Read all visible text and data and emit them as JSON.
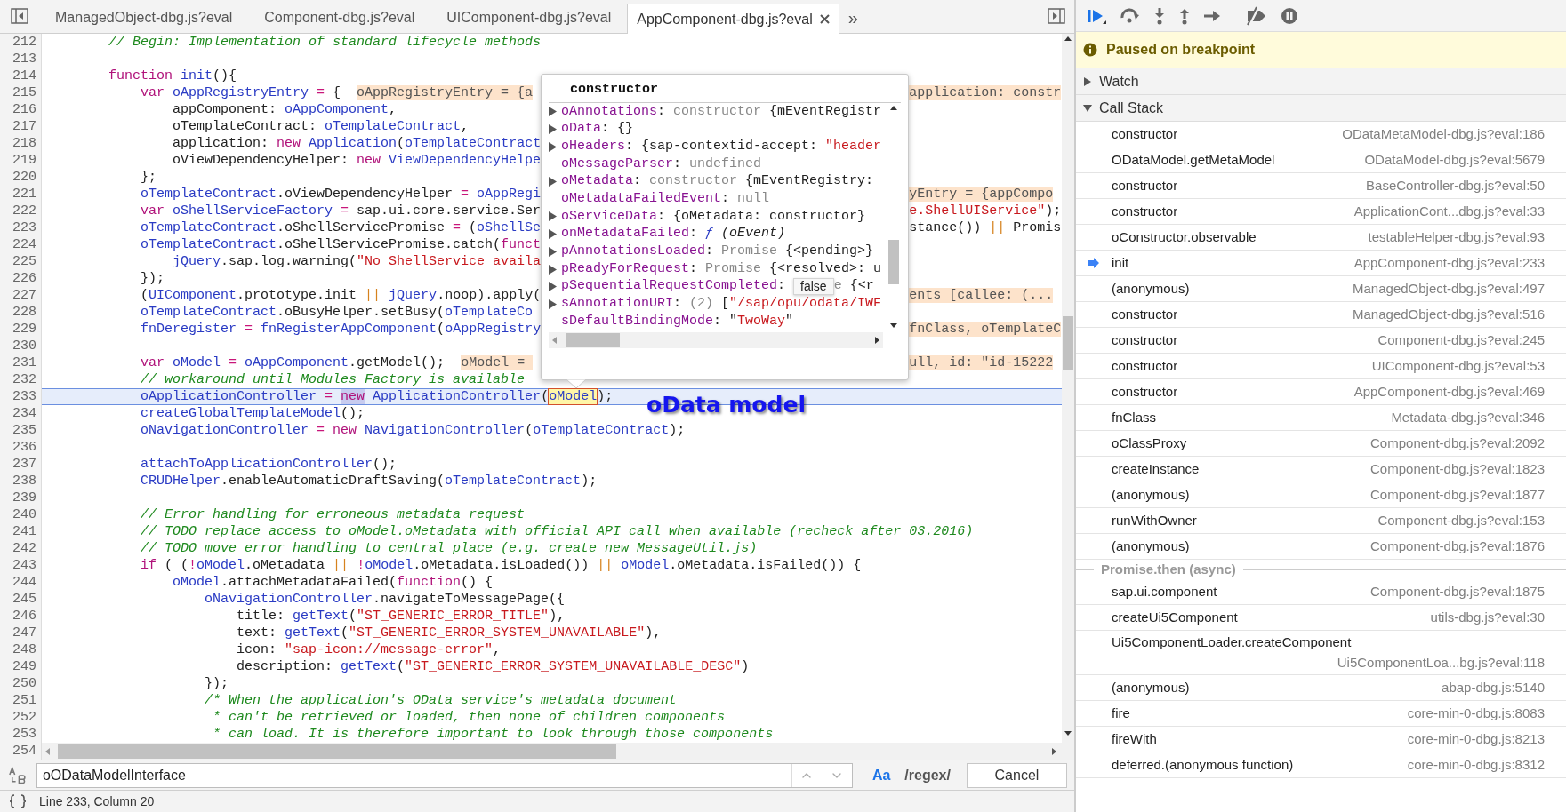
{
  "tabs": [
    {
      "label": "ManagedObject-dbg.js?eval",
      "selected": false,
      "closable": false
    },
    {
      "label": "Component-dbg.js?eval",
      "selected": false,
      "closable": false
    },
    {
      "label": "UIComponent-dbg.js?eval",
      "selected": false,
      "closable": false
    },
    {
      "label": "AppComponent-dbg.js?eval",
      "selected": true,
      "closable": true
    }
  ],
  "more_tabs": "»",
  "code_lines": [
    {
      "n": "212",
      "current": false,
      "tokens": [
        {
          "kind": "cm",
          "text": "        // Begin: Implementation of standard lifecycle methods"
        }
      ]
    },
    {
      "n": "213",
      "current": false
    },
    {
      "n": "214",
      "current": false,
      "tokens": [
        {
          "kind": "kw",
          "text": "        function "
        },
        {
          "kind": "id",
          "text": "init"
        },
        {
          "kind": "pl",
          "text": "(){"
        }
      ]
    },
    {
      "n": "215",
      "current": false,
      "tokens": [
        {
          "kind": "kw",
          "text": "            var "
        },
        {
          "kind": "id",
          "text": "oAppRegistryEntry"
        },
        {
          "kind": "op",
          "text": " = "
        },
        {
          "kind": "pl",
          "text": "{  "
        },
        {
          "kind": "hint",
          "text": "oAppRegistryEntry = {a"
        }
      ],
      "right": [
        {
          "kind": "hint",
          "text": "application: constr"
        }
      ]
    },
    {
      "n": "216",
      "current": false,
      "tokens": [
        {
          "kind": "pl",
          "text": "                appComponent: "
        },
        {
          "kind": "id",
          "text": "oAppComponent"
        },
        {
          "kind": "pl",
          "text": ","
        }
      ]
    },
    {
      "n": "217",
      "current": false,
      "tokens": [
        {
          "kind": "pl",
          "text": "                oTemplateContract: "
        },
        {
          "kind": "id",
          "text": "oTemplateContract"
        },
        {
          "kind": "pl",
          "text": ","
        }
      ]
    },
    {
      "n": "218",
      "current": false,
      "tokens": [
        {
          "kind": "pl",
          "text": "                application: "
        },
        {
          "kind": "kw",
          "text": "new "
        },
        {
          "kind": "id",
          "text": "Application"
        },
        {
          "kind": "pl",
          "text": "("
        },
        {
          "kind": "id",
          "text": "oTemplateContract"
        }
      ]
    },
    {
      "n": "219",
      "current": false,
      "tokens": [
        {
          "kind": "pl",
          "text": "                oViewDependencyHelper: "
        },
        {
          "kind": "kw",
          "text": "new "
        },
        {
          "kind": "id",
          "text": "ViewDependencyHelpe"
        }
      ]
    },
    {
      "n": "220",
      "current": false,
      "tokens": [
        {
          "kind": "pl",
          "text": "            };"
        }
      ]
    },
    {
      "n": "221",
      "current": false,
      "tokens": [
        {
          "kind": "id",
          "text": "            oTemplateContract"
        },
        {
          "kind": "pl",
          "text": ".oViewDependencyHelper"
        },
        {
          "kind": "op",
          "text": " = "
        },
        {
          "kind": "id",
          "text": "oAppRegi"
        }
      ],
      "right": [
        {
          "kind": "hint",
          "text": "yEntry = {appCompo"
        }
      ]
    },
    {
      "n": "222",
      "current": false,
      "tokens": [
        {
          "kind": "kw",
          "text": "            var "
        },
        {
          "kind": "id",
          "text": "oShellServiceFactory"
        },
        {
          "kind": "op",
          "text": " = "
        },
        {
          "kind": "pl",
          "text": "sap.ui.core.service.Ser"
        }
      ],
      "right": [
        {
          "kind": "st",
          "text": "e.ShellUIService\""
        },
        {
          "kind": "pl",
          "text": ");"
        }
      ]
    },
    {
      "n": "223",
      "current": false,
      "tokens": [
        {
          "kind": "id",
          "text": "            oTemplateContract"
        },
        {
          "kind": "pl",
          "text": ".oShellServicePromise"
        },
        {
          "kind": "op",
          "text": " = "
        },
        {
          "kind": "pl",
          "text": "("
        },
        {
          "kind": "id",
          "text": "oShellSe"
        }
      ],
      "right": [
        {
          "kind": "pl",
          "text": "stance()) "
        },
        {
          "kind": "or",
          "text": "||"
        },
        {
          "kind": "pl",
          "text": " Promis"
        }
      ]
    },
    {
      "n": "224",
      "current": false,
      "tokens": [
        {
          "kind": "id",
          "text": "            oTemplateContract"
        },
        {
          "kind": "pl",
          "text": ".oShellServicePromise.catch("
        },
        {
          "kind": "kw",
          "text": "funct"
        }
      ]
    },
    {
      "n": "225",
      "current": false,
      "tokens": [
        {
          "kind": "id",
          "text": "                jQuery"
        },
        {
          "kind": "pl",
          "text": ".sap.log.warning("
        },
        {
          "kind": "st",
          "text": "\"No ShellService availa"
        }
      ]
    },
    {
      "n": "226",
      "current": false,
      "tokens": [
        {
          "kind": "pl",
          "text": "            });"
        }
      ]
    },
    {
      "n": "227",
      "current": false,
      "tokens": [
        {
          "kind": "pl",
          "text": "            ("
        },
        {
          "kind": "id",
          "text": "UIComponent"
        },
        {
          "kind": "pl",
          "text": ".prototype.init "
        },
        {
          "kind": "or",
          "text": "||"
        },
        {
          "kind": "id",
          "text": " jQuery"
        },
        {
          "kind": "pl",
          "text": ".noop).apply("
        }
      ],
      "right": [
        {
          "kind": "hint",
          "text": "ents [callee: (..."
        }
      ]
    },
    {
      "n": "228",
      "current": false,
      "tokens": [
        {
          "kind": "id",
          "text": "            oTemplateContract"
        },
        {
          "kind": "pl",
          "text": ".oBusyHelper.setBusy("
        },
        {
          "kind": "id",
          "text": "oTemplateCo"
        }
      ]
    },
    {
      "n": "229",
      "current": false,
      "tokens": [
        {
          "kind": "id",
          "text": "            fnDeregister"
        },
        {
          "kind": "op",
          "text": " = "
        },
        {
          "kind": "id",
          "text": "fnRegisterAppComponent"
        },
        {
          "kind": "pl",
          "text": "("
        },
        {
          "kind": "id",
          "text": "oAppRegistry"
        }
      ],
      "right": [
        {
          "kind": "hint",
          "text": "fnClass, oTemplateC"
        }
      ]
    },
    {
      "n": "230",
      "current": false
    },
    {
      "n": "231",
      "current": false,
      "tokens": [
        {
          "kind": "kw",
          "text": "            var "
        },
        {
          "kind": "id",
          "text": "oModel"
        },
        {
          "kind": "op",
          "text": " = "
        },
        {
          "kind": "id",
          "text": "oAppComponent"
        },
        {
          "kind": "pl",
          "text": ".getModel();  "
        },
        {
          "kind": "hint",
          "text": "oModel = "
        }
      ],
      "right": [
        {
          "kind": "hint",
          "text": "ull, id: \"id-15222"
        }
      ]
    },
    {
      "n": "232",
      "current": false,
      "tokens": [
        {
          "kind": "cm",
          "text": "            // workaround until Modules Factory is available"
        }
      ]
    },
    {
      "n": "233",
      "current": true,
      "tokens": [
        {
          "kind": "id",
          "text": "            oApplicationController"
        },
        {
          "kind": "op",
          "text": " = "
        },
        {
          "kind": "sel",
          "text": "new"
        },
        {
          "kind": "id",
          "text": " ApplicationController"
        },
        {
          "kind": "pl",
          "text": "("
        },
        {
          "kind": "box",
          "text": "oModel"
        },
        {
          "kind": "pl",
          "text": ");"
        }
      ]
    },
    {
      "n": "234",
      "current": false,
      "tokens": [
        {
          "kind": "id",
          "text": "            createGlobalTemplateModel"
        },
        {
          "kind": "pl",
          "text": "();"
        }
      ]
    },
    {
      "n": "235",
      "current": false,
      "tokens": [
        {
          "kind": "id",
          "text": "            oNavigationController"
        },
        {
          "kind": "op",
          "text": " = "
        },
        {
          "kind": "kw",
          "text": "new "
        },
        {
          "kind": "id",
          "text": "NavigationController"
        },
        {
          "kind": "pl",
          "text": "("
        },
        {
          "kind": "id",
          "text": "oTemplateContract"
        },
        {
          "kind": "pl",
          "text": ");"
        }
      ]
    },
    {
      "n": "236",
      "current": false
    },
    {
      "n": "237",
      "current": false,
      "tokens": [
        {
          "kind": "id",
          "text": "            attachToApplicationController"
        },
        {
          "kind": "pl",
          "text": "();"
        }
      ]
    },
    {
      "n": "238",
      "current": false,
      "tokens": [
        {
          "kind": "id",
          "text": "            CRUDHelper"
        },
        {
          "kind": "pl",
          "text": ".enableAutomaticDraftSaving("
        },
        {
          "kind": "id",
          "text": "oTemplateContract"
        },
        {
          "kind": "pl",
          "text": ");"
        }
      ]
    },
    {
      "n": "239",
      "current": false
    },
    {
      "n": "240",
      "current": false,
      "tokens": [
        {
          "kind": "cm",
          "text": "            // Error handling for erroneous metadata request"
        }
      ]
    },
    {
      "n": "241",
      "current": false,
      "tokens": [
        {
          "kind": "cm",
          "text": "            // TODO replace access to oModel.oMetadata with official API call when available (recheck after 03.2016)"
        }
      ]
    },
    {
      "n": "242",
      "current": false,
      "tokens": [
        {
          "kind": "cm",
          "text": "            // TODO move error handling to central place (e.g. create new MessageUtil.js)"
        }
      ]
    },
    {
      "n": "243",
      "current": false,
      "tokens": [
        {
          "kind": "kw",
          "text": "            if"
        },
        {
          "kind": "pl",
          "text": " ( ("
        },
        {
          "kind": "op",
          "text": "!"
        },
        {
          "kind": "id",
          "text": "oModel"
        },
        {
          "kind": "pl",
          "text": ".oMetadata "
        },
        {
          "kind": "or",
          "text": "||"
        },
        {
          "kind": "op",
          "text": " !"
        },
        {
          "kind": "id",
          "text": "oModel"
        },
        {
          "kind": "pl",
          "text": ".oMetadata.isLoaded()) "
        },
        {
          "kind": "or",
          "text": "||"
        },
        {
          "kind": "id",
          "text": " oModel"
        },
        {
          "kind": "pl",
          "text": ".oMetadata.isFailed()) {"
        }
      ]
    },
    {
      "n": "244",
      "current": false,
      "tokens": [
        {
          "kind": "id",
          "text": "                oModel"
        },
        {
          "kind": "pl",
          "text": ".attachMetadataFailed("
        },
        {
          "kind": "kw",
          "text": "function"
        },
        {
          "kind": "pl",
          "text": "() {"
        }
      ]
    },
    {
      "n": "245",
      "current": false,
      "tokens": [
        {
          "kind": "id",
          "text": "                    oNavigationController"
        },
        {
          "kind": "pl",
          "text": ".navigateToMessagePage({"
        }
      ]
    },
    {
      "n": "246",
      "current": false,
      "tokens": [
        {
          "kind": "pl",
          "text": "                        title: "
        },
        {
          "kind": "id",
          "text": "getText"
        },
        {
          "kind": "pl",
          "text": "("
        },
        {
          "kind": "st",
          "text": "\"ST_GENERIC_ERROR_TITLE\""
        },
        {
          "kind": "pl",
          "text": "),"
        }
      ]
    },
    {
      "n": "247",
      "current": false,
      "tokens": [
        {
          "kind": "pl",
          "text": "                        text: "
        },
        {
          "kind": "id",
          "text": "getText"
        },
        {
          "kind": "pl",
          "text": "("
        },
        {
          "kind": "st",
          "text": "\"ST_GENERIC_ERROR_SYSTEM_UNAVAILABLE\""
        },
        {
          "kind": "pl",
          "text": "),"
        }
      ]
    },
    {
      "n": "248",
      "current": false,
      "tokens": [
        {
          "kind": "pl",
          "text": "                        icon: "
        },
        {
          "kind": "st",
          "text": "\"sap-icon://message-error\""
        },
        {
          "kind": "pl",
          "text": ","
        }
      ]
    },
    {
      "n": "249",
      "current": false,
      "tokens": [
        {
          "kind": "pl",
          "text": "                        description: "
        },
        {
          "kind": "id",
          "text": "getText"
        },
        {
          "kind": "pl",
          "text": "("
        },
        {
          "kind": "st",
          "text": "\"ST_GENERIC_ERROR_SYSTEM_UNAVAILABLE_DESC\""
        },
        {
          "kind": "pl",
          "text": ")"
        }
      ]
    },
    {
      "n": "250",
      "current": false,
      "tokens": [
        {
          "kind": "pl",
          "text": "                    });"
        }
      ]
    },
    {
      "n": "251",
      "current": false,
      "tokens": [
        {
          "kind": "cm",
          "text": "                    /* When the application's OData service's metadata document"
        }
      ]
    },
    {
      "n": "252",
      "current": false,
      "tokens": [
        {
          "kind": "cm",
          "text": "                     * can't be retrieved or loaded, then none of children components"
        }
      ]
    },
    {
      "n": "253",
      "current": false,
      "tokens": [
        {
          "kind": "cm",
          "text": "                     * can load. It is therefore important to look through those components"
        }
      ]
    },
    {
      "n": "254",
      "current": false
    }
  ],
  "popover": {
    "title": "constructor",
    "properties": [
      {
        "kind": "object",
        "name": "oAnnotations",
        "value": [
          {
            "kind": "pl",
            "text": ": "
          },
          {
            "kind": "gy",
            "text": "constructor"
          },
          {
            "kind": "pl",
            "text": " {mEventRegistr"
          }
        ]
      },
      {
        "kind": "object",
        "name": "oData",
        "value": [
          {
            "kind": "pl",
            "text": ": {}"
          }
        ]
      },
      {
        "kind": "object",
        "name": "oHeaders",
        "value": [
          {
            "kind": "pl",
            "text": ": {sap-contextid-accept: "
          },
          {
            "kind": "st",
            "text": "\"header"
          }
        ]
      },
      {
        "kind": "value",
        "name": "oMessageParser",
        "value": [
          {
            "kind": "pl",
            "text": ": "
          },
          {
            "kind": "gy",
            "text": "undefined"
          }
        ]
      },
      {
        "kind": "object",
        "name": "oMetadata",
        "value": [
          {
            "kind": "pl",
            "text": ": "
          },
          {
            "kind": "gy",
            "text": "constructor"
          },
          {
            "kind": "pl",
            "text": " {mEventRegistry:"
          }
        ]
      },
      {
        "kind": "value",
        "name": "oMetadataFailedEvent",
        "value": [
          {
            "kind": "pl",
            "text": ": "
          },
          {
            "kind": "gy",
            "text": "null"
          }
        ]
      },
      {
        "kind": "object",
        "name": "oServiceData",
        "value": [
          {
            "kind": "pl",
            "text": ": {oMetadata: constructor}"
          }
        ]
      },
      {
        "kind": "object",
        "name": "onMetadataFailed",
        "value": [
          {
            "kind": "pl",
            "text": ": "
          },
          {
            "kind": "fn",
            "text": "ƒ"
          },
          {
            "kind": "it",
            "text": " (oEvent)"
          }
        ]
      },
      {
        "kind": "object",
        "name": "pAnnotationsLoaded",
        "value": [
          {
            "kind": "pl",
            "text": ": "
          },
          {
            "kind": "gy",
            "text": "Promise"
          },
          {
            "kind": "pl",
            "text": " {<pending>}"
          }
        ]
      },
      {
        "kind": "object",
        "name": "pReadyForRequest",
        "value": [
          {
            "kind": "pl",
            "text": ": "
          },
          {
            "kind": "gy",
            "text": "Promise"
          },
          {
            "kind": "pl",
            "text": " {<resolved>: u"
          }
        ]
      },
      {
        "kind": "object",
        "name": "pSequentialRequestCompleted",
        "tooltip": "false",
        "value": [
          {
            "kind": "pl",
            "text": ":"
          },
          {
            "kind": "gy",
            "text": "e"
          },
          {
            "kind": "pl",
            "text": " {<r"
          }
        ]
      },
      {
        "kind": "object",
        "name": "sAnnotationURI",
        "value": [
          {
            "kind": "pl",
            "text": ": "
          },
          {
            "kind": "gy",
            "text": "(2)"
          },
          {
            "kind": "pl",
            "text": " ["
          },
          {
            "kind": "st",
            "text": "\"/sap/opu/odata/IWF"
          }
        ]
      },
      {
        "kind": "value",
        "name": "sDefaultBindingMode",
        "value": [
          {
            "kind": "pl",
            "text": ": \""
          },
          {
            "kind": "st",
            "text": "TwoWay"
          },
          {
            "kind": "pl",
            "text": "\""
          }
        ]
      }
    ]
  },
  "annotation": "oData model",
  "search": {
    "value": "oODataModelInterface",
    "case_button": "Aa",
    "regex_button": "/regex/",
    "cancel": "Cancel"
  },
  "status_bar": "Line 233, Column 20",
  "debugger": {
    "banner": "Paused on breakpoint",
    "watch": {
      "label": "Watch",
      "expanded": false
    },
    "call_stack": {
      "label": "Call Stack",
      "expanded": true,
      "frames": [
        {
          "kind": "frame",
          "name": "constructor",
          "location": "ODataMetaModel-dbg.js?eval:186",
          "selected": false
        },
        {
          "kind": "frame",
          "name": "ODataModel.getMetaModel",
          "location": "ODataModel-dbg.js?eval:5679",
          "selected": false
        },
        {
          "kind": "frame",
          "name": "constructor",
          "location": "BaseController-dbg.js?eval:50",
          "selected": false
        },
        {
          "kind": "frame",
          "name": "constructor",
          "location": "ApplicationCont...dbg.js?eval:33",
          "selected": false
        },
        {
          "kind": "frame",
          "name": "oConstructor.observable",
          "location": "testableHelper-dbg.js?eval:93",
          "selected": false
        },
        {
          "kind": "frame",
          "name": "init",
          "location": "AppComponent-dbg.js?eval:233",
          "selected": true
        },
        {
          "kind": "frame",
          "name": "(anonymous)",
          "location": "ManagedObject-dbg.js?eval:497",
          "selected": false
        },
        {
          "kind": "frame",
          "name": "constructor",
          "location": "ManagedObject-dbg.js?eval:516",
          "selected": false
        },
        {
          "kind": "frame",
          "name": "constructor",
          "location": "Component-dbg.js?eval:245",
          "selected": false
        },
        {
          "kind": "frame",
          "name": "constructor",
          "location": "UIComponent-dbg.js?eval:53",
          "selected": false
        },
        {
          "kind": "frame",
          "name": "constructor",
          "location": "AppComponent-dbg.js?eval:469",
          "selected": false
        },
        {
          "kind": "frame",
          "name": "fnClass",
          "location": "Metadata-dbg.js?eval:346",
          "selected": false
        },
        {
          "kind": "frame",
          "name": "oClassProxy",
          "location": "Component-dbg.js?eval:2092",
          "selected": false
        },
        {
          "kind": "frame",
          "name": "createInstance",
          "location": "Component-dbg.js?eval:1823",
          "selected": false
        },
        {
          "kind": "frame",
          "name": "(anonymous)",
          "location": "Component-dbg.js?eval:1877",
          "selected": false
        },
        {
          "kind": "frame",
          "name": "runWithOwner",
          "location": "Component-dbg.js?eval:153",
          "selected": false
        },
        {
          "kind": "frame",
          "name": "(anonymous)",
          "location": "Component-dbg.js?eval:1876",
          "selected": false
        },
        {
          "kind": "async",
          "label": "Promise.then (async)"
        },
        {
          "kind": "frame",
          "name": "sap.ui.component",
          "location": "Component-dbg.js?eval:1875",
          "selected": false
        },
        {
          "kind": "frame",
          "name": "createUi5Component",
          "location": "utils-dbg.js?eval:30",
          "selected": false
        },
        {
          "kind": "wrapped",
          "name": "Ui5ComponentLoader.createComponent",
          "location": "Ui5ComponentLoa...bg.js?eval:118",
          "selected": false
        },
        {
          "kind": "frame",
          "name": "(anonymous)",
          "location": "abap-dbg.js:5140",
          "selected": false
        },
        {
          "kind": "frame",
          "name": "fire",
          "location": "core-min-0-dbg.js:8083",
          "selected": false
        },
        {
          "kind": "frame",
          "name": "fireWith",
          "location": "core-min-0-dbg.js:8213",
          "selected": false
        },
        {
          "kind": "frame",
          "name": "deferred.(anonymous function)",
          "location": "core-min-0-dbg.js:8312",
          "selected": false
        }
      ]
    }
  }
}
